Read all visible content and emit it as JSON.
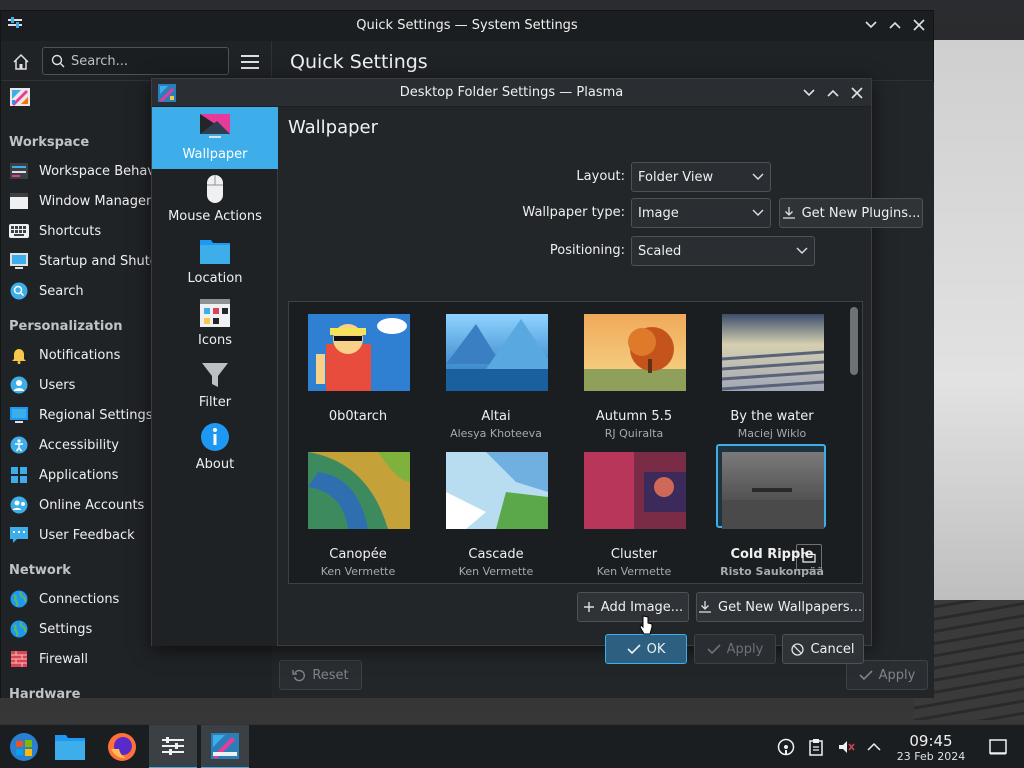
{
  "system_settings": {
    "window_title": "Quick Settings — System Settings",
    "page_title": "Quick Settings",
    "search_placeholder": "Search...",
    "sections": {
      "workspace": "Workspace",
      "personalization": "Personalization",
      "network": "Network",
      "hardware": "Hardware"
    },
    "workspace_items": [
      "Workspace Behavio",
      "Window Managem",
      "Shortcuts",
      "Startup and Shutdo",
      "Search"
    ],
    "personalization_items": [
      "Notifications",
      "Users",
      "Regional Settings",
      "Accessibility",
      "Applications",
      "Online Accounts",
      "User Feedback"
    ],
    "network_items": [
      "Connections",
      "Settings",
      "Firewall"
    ],
    "reset_label": "Reset",
    "apply_label": "Apply"
  },
  "dialog": {
    "title": "Desktop Folder Settings — Plasma",
    "heading": "Wallpaper",
    "categories": [
      "Wallpaper",
      "Mouse Actions",
      "Location",
      "Icons",
      "Filter",
      "About"
    ],
    "active_category": "Wallpaper",
    "layout_label": "Layout:",
    "layout_value": "Folder View",
    "wallpaper_type_label": "Wallpaper type:",
    "wallpaper_type_value": "Image",
    "get_plugins_label": "Get New Plugins...",
    "positioning_label": "Positioning:",
    "positioning_value": "Scaled",
    "wallpapers": [
      {
        "name": "0b0tarch",
        "author": ""
      },
      {
        "name": "Altai",
        "author": "Alesya Khoteeva"
      },
      {
        "name": "Autumn 5.5",
        "author": "RJ Quiralta"
      },
      {
        "name": "By the water",
        "author": "Maciej Wiklo"
      },
      {
        "name": "Canopée",
        "author": "Ken Vermette"
      },
      {
        "name": "Cascade",
        "author": "Ken Vermette"
      },
      {
        "name": "Cluster",
        "author": "Ken Vermette"
      },
      {
        "name": "Cold Ripple",
        "author": "Risto Saukonpää",
        "selected": true
      }
    ],
    "add_image_label": "Add Image...",
    "get_wallpapers_label": "Get New Wallpapers...",
    "ok_label": "OK",
    "apply_label": "Apply",
    "cancel_label": "Cancel"
  },
  "taskbar": {
    "time": "09:45",
    "date": "23 Feb 2024"
  },
  "colors": {
    "accent": "#3daee9",
    "window_bg": "#232629",
    "sidebar_bg": "#202326"
  }
}
